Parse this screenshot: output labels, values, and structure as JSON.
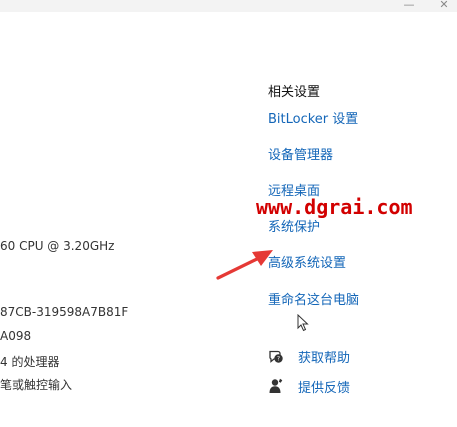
{
  "window_controls": {
    "minimize": "—",
    "close": "✕"
  },
  "system_info": {
    "cpu": "60  CPU @ 3.20GHz",
    "device_id": "87CB-319598A7B81F",
    "product_id": "A098",
    "system_type": "4 的处理器",
    "pen_touch": "笔或触控输入"
  },
  "related_settings": {
    "title": "相关设置",
    "links": [
      "BitLocker 设置",
      "设备管理器",
      "远程桌面",
      "系统保护",
      "高级系统设置",
      "重命名这台电脑"
    ]
  },
  "help": {
    "get_help": "获取帮助",
    "feedback": "提供反馈"
  },
  "watermark": {
    "text": "www.dgrai.com"
  },
  "colors": {
    "link": "#1366b8",
    "watermark": "#d20000",
    "arrow": "#e53935"
  },
  "icons": {
    "get_help": "chat-help-icon",
    "feedback": "feedback-person-icon",
    "cursor": "mouse-pointer-icon",
    "arrow": "red-pointer-arrow-icon"
  }
}
